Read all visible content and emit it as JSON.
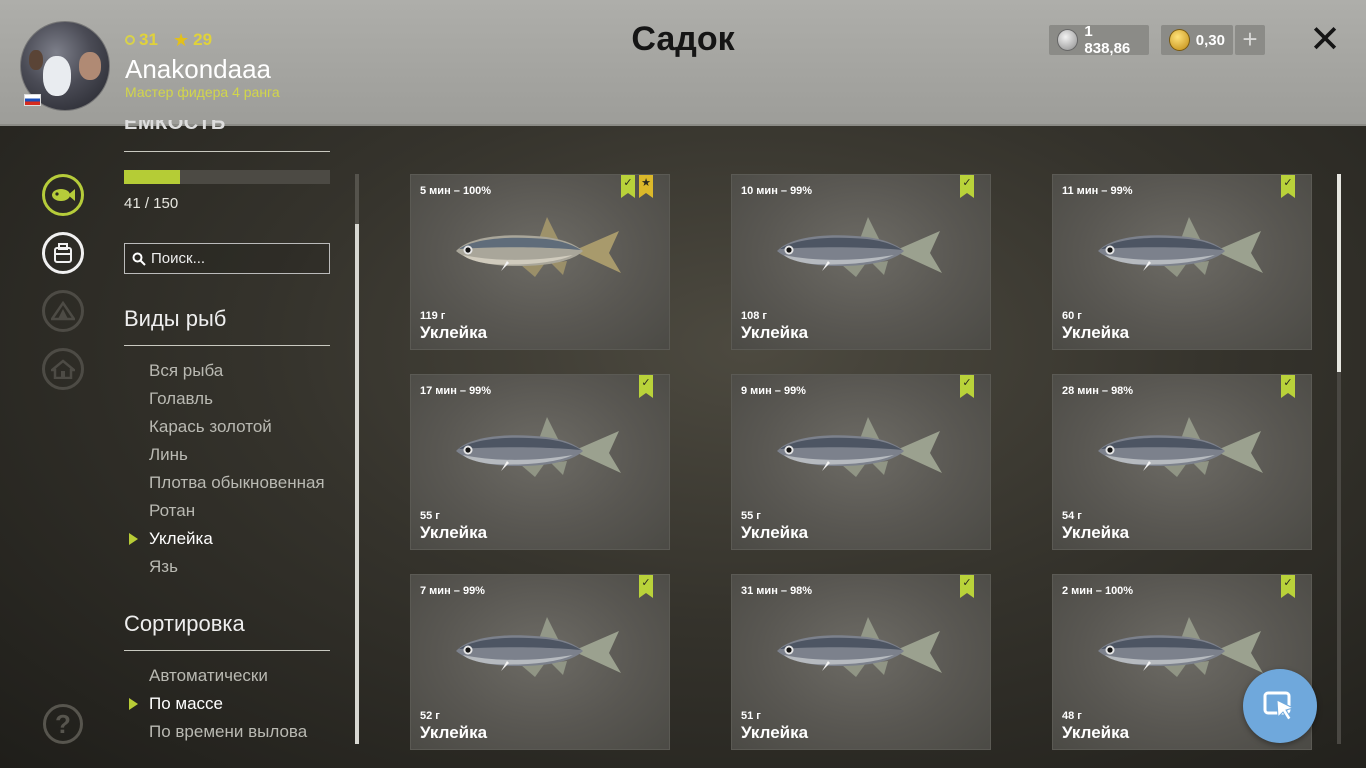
{
  "header": {
    "title": "Садок",
    "level": "31",
    "stars": "29",
    "username": "Anakondaaa",
    "rank": "Мастер фидера 4 ранга",
    "silver": "1 838,86",
    "gold": "0,30",
    "plus": "+",
    "close": "✕"
  },
  "sidebar": {
    "capacity_label": "ЕМКОСТЬ",
    "capacity_used": 41,
    "capacity_max": 150,
    "capacity_text": "41 / 150",
    "search_placeholder": "Поиск...",
    "species_title": "Виды рыб",
    "species": [
      {
        "label": "Вся рыба",
        "selected": false
      },
      {
        "label": "Голавль",
        "selected": false
      },
      {
        "label": "Карась золотой",
        "selected": false
      },
      {
        "label": "Линь",
        "selected": false
      },
      {
        "label": "Плотва обыкновенная",
        "selected": false
      },
      {
        "label": "Ротан",
        "selected": false
      },
      {
        "label": "Уклейка",
        "selected": true
      },
      {
        "label": "Язь",
        "selected": false
      }
    ],
    "sort_title": "Сортировка",
    "sort": [
      {
        "label": "Автоматически",
        "selected": false
      },
      {
        "label": "По массе",
        "selected": true
      },
      {
        "label": "По времени вылова",
        "selected": false
      }
    ],
    "help": "?"
  },
  "fish": [
    {
      "time": "5 мин – 100%",
      "weight": "119 г",
      "name": "Уклейка",
      "trophy": true,
      "variant": "pale"
    },
    {
      "time": "10 мин – 99%",
      "weight": "108 г",
      "name": "Уклейка",
      "trophy": false,
      "variant": "dark"
    },
    {
      "time": "11 мин – 99%",
      "weight": "60 г",
      "name": "Уклейка",
      "trophy": false,
      "variant": "dark"
    },
    {
      "time": "17 мин – 99%",
      "weight": "55 г",
      "name": "Уклейка",
      "trophy": false,
      "variant": "dark"
    },
    {
      "time": "9 мин – 99%",
      "weight": "55 г",
      "name": "Уклейка",
      "trophy": false,
      "variant": "dark"
    },
    {
      "time": "28 мин – 98%",
      "weight": "54 г",
      "name": "Уклейка",
      "trophy": false,
      "variant": "dark"
    },
    {
      "time": "7 мин – 99%",
      "weight": "52 г",
      "name": "Уклейка",
      "trophy": false,
      "variant": "dark"
    },
    {
      "time": "31 мин – 98%",
      "weight": "51 г",
      "name": "Уклейка",
      "trophy": false,
      "variant": "dark"
    },
    {
      "time": "2 мин – 100%",
      "weight": "48 г",
      "name": "Уклейка",
      "trophy": false,
      "variant": "dark"
    }
  ],
  "colors": {
    "accent": "#b5cc36",
    "trophy": "#dbb82a",
    "fab": "#6fa8dc"
  }
}
